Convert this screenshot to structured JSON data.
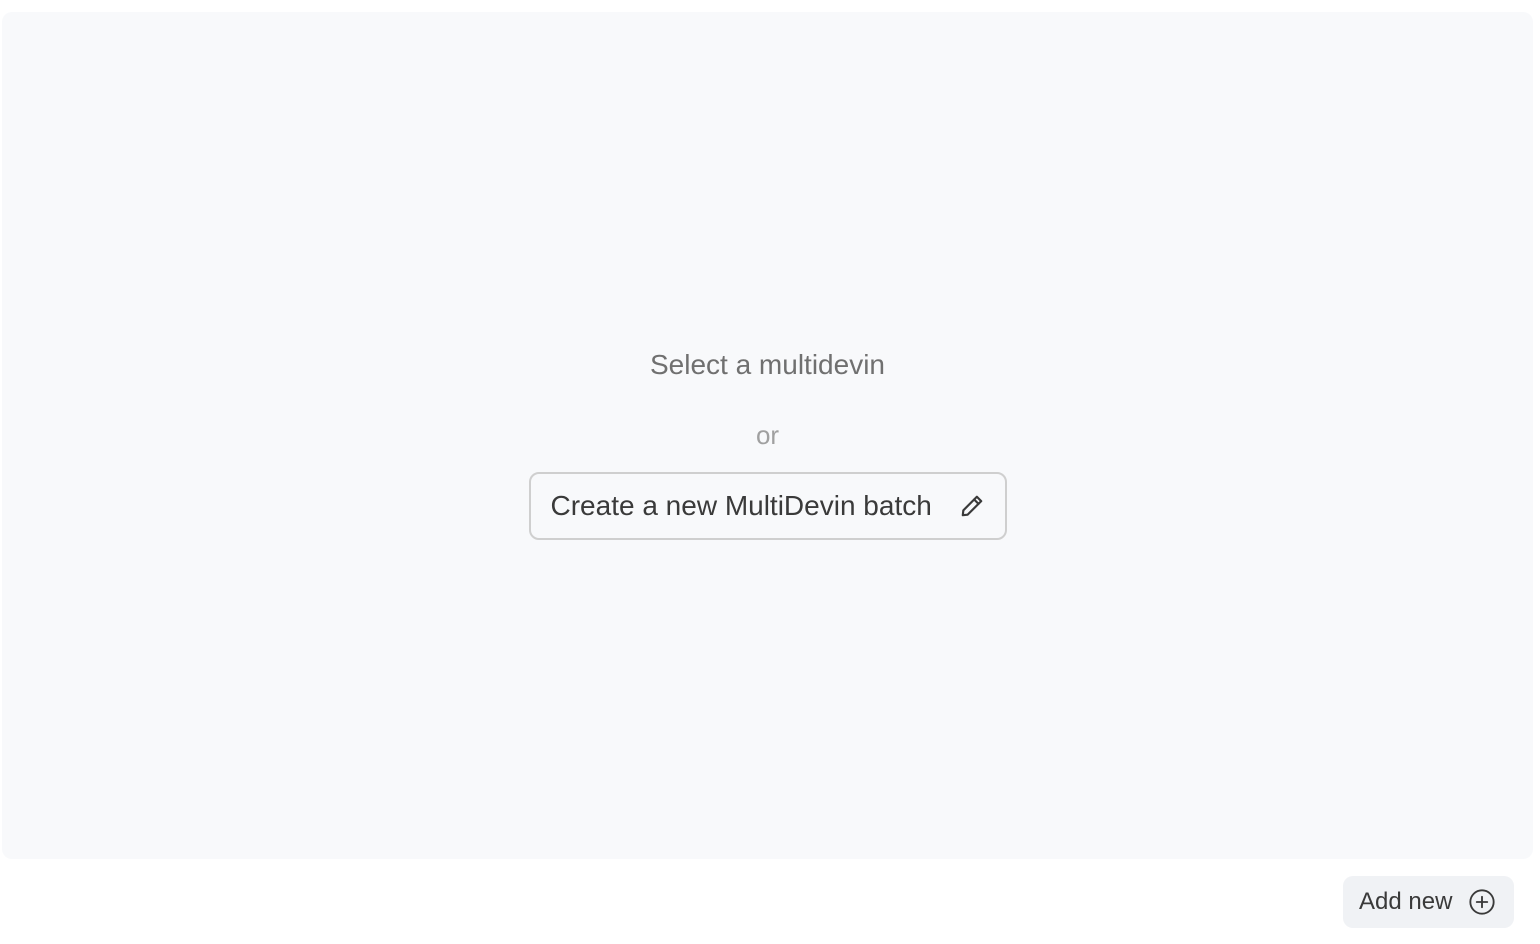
{
  "empty_state": {
    "prompt": "Select a multidevin",
    "separator": "or",
    "create_button_label": "Create a new MultiDevin batch",
    "create_button_icon": "pencil-icon"
  },
  "footer": {
    "add_button_label": "Add new",
    "add_button_icon": "plus-circle-icon"
  },
  "colors": {
    "panel_background": "#f8f9fb",
    "page_background": "#ffffff",
    "text_primary": "#3a3a3a",
    "text_muted": "#707070",
    "text_faint": "#a0a0a0",
    "button_border": "#cfcfcf",
    "add_button_background": "#f0f2f5"
  }
}
